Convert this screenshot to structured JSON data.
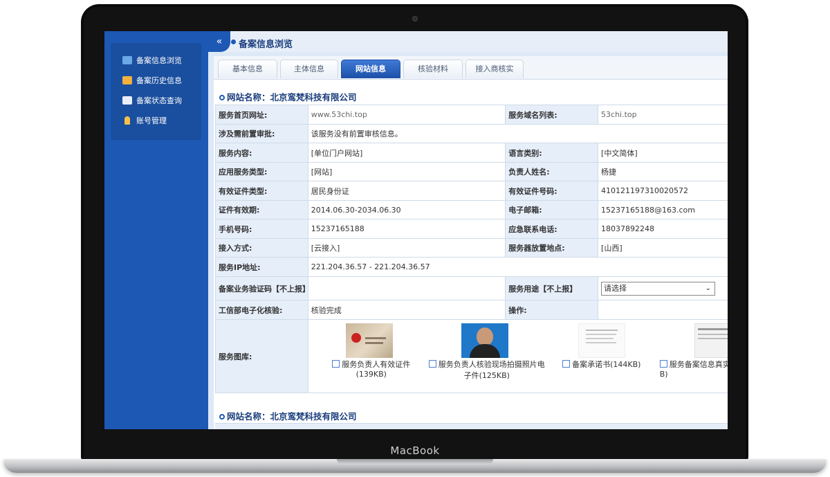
{
  "device": {
    "brand": "MacBook"
  },
  "sidebar": {
    "items": [
      {
        "label": "备案信息浏览",
        "icon": "browse-icon",
        "color": "#6aa8e8"
      },
      {
        "label": "备案历史信息",
        "icon": "history-icon",
        "color": "#f2b13c"
      },
      {
        "label": "备案状态查询",
        "icon": "status-query-icon",
        "color": "#e9eef6"
      },
      {
        "label": "账号管理",
        "icon": "account-icon",
        "color": "#f5c14a"
      }
    ]
  },
  "header": {
    "collapse_glyph": "«",
    "title": "备案信息浏览"
  },
  "tabs": [
    "基本信息",
    "主体信息",
    "网站信息",
    "核验材料",
    "接入商核实"
  ],
  "active_tab": "网站信息",
  "section": {
    "title": "网站名称：北京鸾梵科技有限公司"
  },
  "fields": {
    "homepage_label": "服务首页网址:",
    "homepage_value": "www.53chi.top",
    "domain_label": "服务域名列表:",
    "domain_value": "53chi.top",
    "preapproval_label": "涉及需前置审批:",
    "preapproval_value": "该服务没有前置审核信息。",
    "content_label": "服务内容:",
    "content_value": "[单位门户网站]",
    "language_label": "语言类别:",
    "language_value": "[中文简体]",
    "apptype_label": "应用服务类型:",
    "apptype_value": "[网站]",
    "owner_label": "负责人姓名:",
    "owner_value": "杨捷",
    "idtype_label": "有效证件类型:",
    "idtype_value": "居民身份证",
    "idno_label": "有效证件号码:",
    "idno_value": "410121197310020572",
    "idvalid_label": "证件有效期:",
    "idvalid_value": "2014.06.30-2034.06.30",
    "email_label": "电子邮箱:",
    "email_value": "15237165188@163.com",
    "phone_label": "手机号码:",
    "phone_value": "15237165188",
    "emergency_label": "应急联系电话:",
    "emergency_value": "18037892248",
    "access_label": "接入方式:",
    "access_value": "[云接入]",
    "location_label": "服务器放置地点:",
    "location_value": "[山西]",
    "ip_label": "服务IP地址:",
    "ip_value": "221.204.36.57 - 221.204.36.57",
    "verifycode_label": "备案业务验证码【不上报】",
    "usage_label": "服务用途【不上报】",
    "usage_select": "请选择",
    "miit_label": "工信部电子化核验:",
    "miit_value": "核验完成",
    "action_label": "操作:",
    "gallery_label": "服务图库:"
  },
  "gallery": [
    {
      "caption": "服务负责人有效证件(139KB)"
    },
    {
      "caption": "服务负责人核验现场拍摄照片电子件(125KB)"
    },
    {
      "caption": "备案承诺书(144KB)"
    },
    {
      "caption": "服务备案信息真实性B)"
    }
  ],
  "section2": {
    "title": "网站名称：北京鸾梵科技有限公司"
  }
}
